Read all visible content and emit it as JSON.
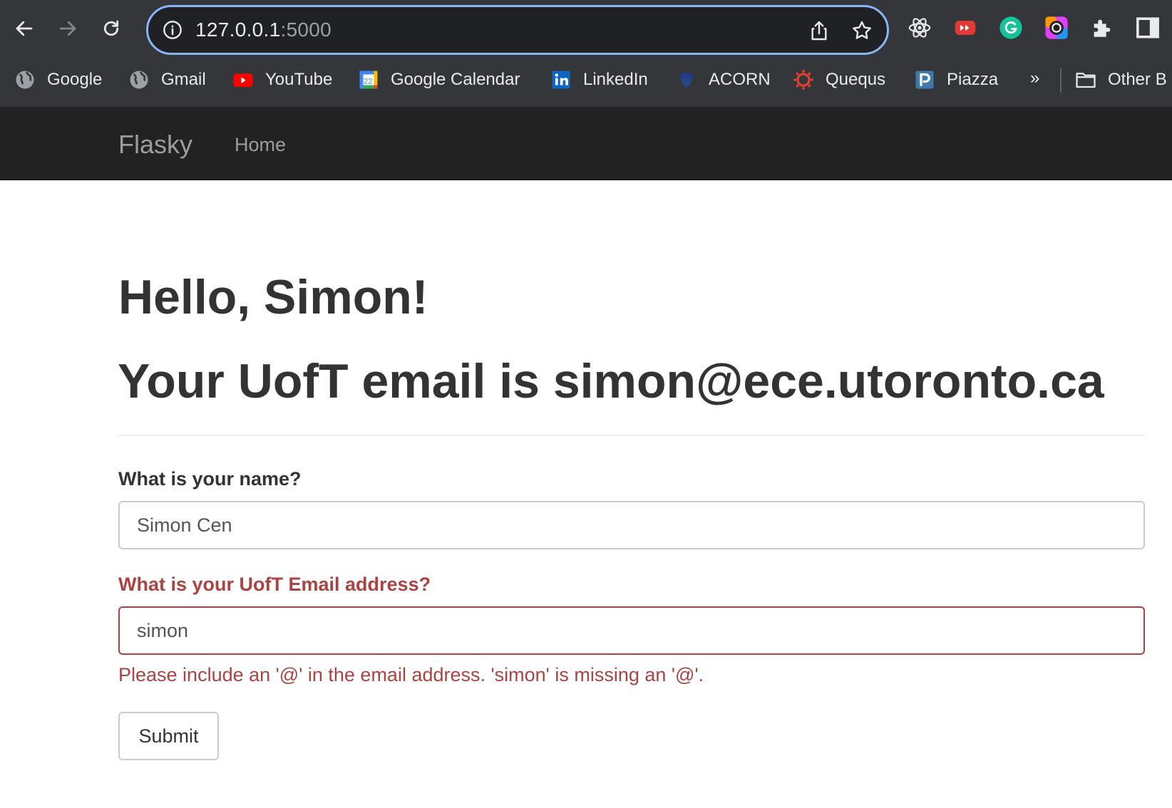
{
  "browser": {
    "url_host": "127.0.0.1",
    "url_port": ":5000",
    "bookmarks": [
      {
        "label": "Google",
        "icon": "globe-icon"
      },
      {
        "label": "Gmail",
        "icon": "globe-icon"
      },
      {
        "label": "YouTube",
        "icon": "youtube-icon"
      },
      {
        "label": "Google Calendar",
        "icon": "calendar-icon",
        "badge": "22"
      },
      {
        "label": "LinkedIn",
        "icon": "linkedin-icon"
      },
      {
        "label": "ACORN",
        "icon": "acorn-icon"
      },
      {
        "label": "Quequs",
        "icon": "canvas-icon"
      },
      {
        "label": "Piazza",
        "icon": "piazza-icon"
      }
    ],
    "overflow_label": "»",
    "other_bookmarks_label": "Other B",
    "colors": {
      "accent": "#8ab4f8",
      "chrome_bg": "#35363a",
      "omnibox_bg": "#202124"
    }
  },
  "navbar": {
    "brand": "Flasky",
    "links": [
      {
        "label": "Home"
      }
    ],
    "bg": "#222222"
  },
  "main": {
    "greeting": "Hello, Simon!",
    "email_line": "Your UofT email is simon@ece.utoronto.ca",
    "form": {
      "name_label": "What is your name?",
      "name_value": "Simon Cen",
      "email_label": "What is your UofT Email address?",
      "email_value": "simon",
      "email_error": "Please include an '@' in the email address. 'simon' is missing an '@'.",
      "submit_label": "Submit"
    },
    "colors": {
      "error": "#a94442"
    }
  }
}
